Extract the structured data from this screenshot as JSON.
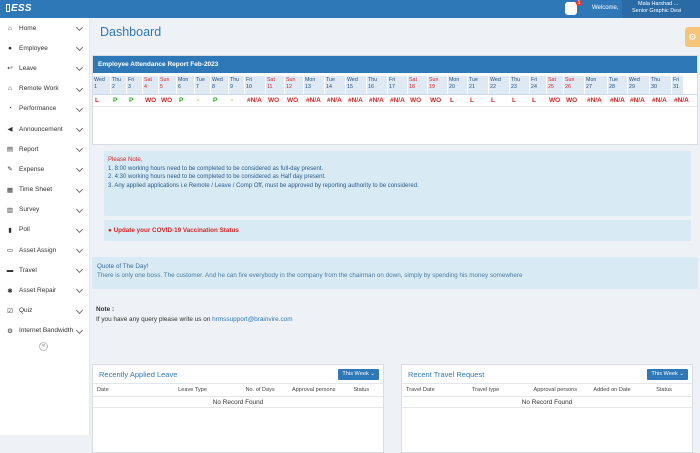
{
  "app": {
    "logo": "ESS",
    "welcome": "Welcome,",
    "user_name": "Mala Harshad ...",
    "user_role": "Senior Graphic Desi",
    "notif_count": "1"
  },
  "sidebar": {
    "items": [
      {
        "label": "Home",
        "icon": "home-icon"
      },
      {
        "label": "Employee",
        "icon": "user-icon"
      },
      {
        "label": "Leave",
        "icon": "leave-icon"
      },
      {
        "label": "Remote Work",
        "icon": "remote-icon"
      },
      {
        "label": "Performance",
        "icon": "performance-icon"
      },
      {
        "label": "Announcement",
        "icon": "megaphone-icon"
      },
      {
        "label": "Report",
        "icon": "report-icon"
      },
      {
        "label": "Expense",
        "icon": "expense-icon"
      },
      {
        "label": "Time Sheet",
        "icon": "timesheet-icon"
      },
      {
        "label": "Survey",
        "icon": "survey-icon"
      },
      {
        "label": "Poll",
        "icon": "poll-icon"
      },
      {
        "label": "Asset Assign",
        "icon": "asset-icon"
      },
      {
        "label": "Travel",
        "icon": "travel-icon"
      },
      {
        "label": "Asset Repair",
        "icon": "wrench-icon"
      },
      {
        "label": "Quiz",
        "icon": "quiz-icon"
      },
      {
        "label": "Internet Bandwidth",
        "icon": "bandwidth-icon"
      }
    ]
  },
  "page": {
    "title": "Dashboard"
  },
  "attendance": {
    "title": "Employee Attendance Report Feb-2023",
    "days": [
      {
        "d": "Wed",
        "n": "1",
        "w": 18,
        "red": false
      },
      {
        "d": "Thu",
        "n": "2",
        "w": 16,
        "red": false
      },
      {
        "d": "Fri",
        "n": "3",
        "w": 16,
        "red": false
      },
      {
        "d": "Sat",
        "n": "4",
        "w": 16,
        "red": true
      },
      {
        "d": "Sun",
        "n": "5",
        "w": 18,
        "red": true
      },
      {
        "d": "Mon",
        "n": "6",
        "w": 18,
        "red": false
      },
      {
        "d": "Tue",
        "n": "7",
        "w": 16,
        "red": false
      },
      {
        "d": "Wed",
        "n": "8",
        "w": 18,
        "red": false
      },
      {
        "d": "Thu",
        "n": "9",
        "w": 16,
        "red": false
      },
      {
        "d": "Fri",
        "n": "10",
        "w": 21,
        "red": false
      },
      {
        "d": "Sat",
        "n": "11",
        "w": 19,
        "red": true
      },
      {
        "d": "Sun",
        "n": "12",
        "w": 19,
        "red": true
      },
      {
        "d": "Mon",
        "n": "13",
        "w": 21,
        "red": false
      },
      {
        "d": "Tue",
        "n": "14",
        "w": 21,
        "red": false
      },
      {
        "d": "Wed",
        "n": "15",
        "w": 21,
        "red": false
      },
      {
        "d": "Thu",
        "n": "16",
        "w": 21,
        "red": false
      },
      {
        "d": "Fri",
        "n": "17",
        "w": 20,
        "red": false
      },
      {
        "d": "Sat",
        "n": "18",
        "w": 20,
        "red": true
      },
      {
        "d": "Sun",
        "n": "19",
        "w": 20,
        "red": true
      },
      {
        "d": "Mon",
        "n": "20",
        "w": 20,
        "red": false
      },
      {
        "d": "Tue",
        "n": "21",
        "w": 21,
        "red": false
      },
      {
        "d": "Wed",
        "n": "22",
        "w": 21,
        "red": false
      },
      {
        "d": "Thu",
        "n": "23",
        "w": 20,
        "red": false
      },
      {
        "d": "Fri",
        "n": "24",
        "w": 17,
        "red": false
      },
      {
        "d": "Sat",
        "n": "25",
        "w": 17,
        "red": true
      },
      {
        "d": "Sun",
        "n": "26",
        "w": 21,
        "red": true
      },
      {
        "d": "Mon",
        "n": "27",
        "w": 23,
        "red": false
      },
      {
        "d": "Tue",
        "n": "28",
        "w": 20,
        "red": false
      },
      {
        "d": "Wed",
        "n": "29",
        "w": 22,
        "red": false
      },
      {
        "d": "Thu",
        "n": "30",
        "w": 22,
        "red": false
      },
      {
        "d": "Fri",
        "n": "31",
        "w": 12,
        "red": false
      }
    ],
    "marks": [
      "L",
      "P",
      "P",
      "WO",
      "WO",
      "P",
      "-",
      "P",
      "-",
      "#N/A",
      "WO",
      "WO",
      "#N/A",
      "#N/A",
      "#N/A",
      "#N/A",
      "#N/A",
      "WO",
      "WO",
      "L",
      "L",
      "L",
      "L",
      "L",
      "WO",
      "WO",
      "#N/A",
      "#N/A",
      "#N/A",
      "#N/A",
      "#N/A"
    ]
  },
  "note": {
    "heading": "Please Note,",
    "lines": [
      "1. 8:00 working hours need to be completed to be considered as full-day present.",
      "2. 4:30 working hours need to be completed to be considered as Half day present.",
      "3. Any applied applications i.e Remote / Leave / Comp Off, must be approved by reporting authority to be considered."
    ]
  },
  "covid": {
    "text": "Update your COVID-19 Vaccination Status"
  },
  "quote": {
    "heading": "Quote of The Day!",
    "text": "There is only one boss. The customer. And he can fire everybody in the company from the chairman on down, simply by spending his money somewhere"
  },
  "contact": {
    "label": "Note :",
    "text": "If you have any query please write us on",
    "email": "hrmssupport@brainvire.com"
  },
  "leave_card": {
    "title": "Recently Applied Leave",
    "filter": "This Week",
    "columns": [
      "Date",
      "Leave Type",
      "No. of Days",
      "Approval persons",
      "Status"
    ],
    "empty": "No Record Found"
  },
  "travel_card": {
    "title": "Recent Travel Request",
    "filter": "This Week",
    "columns": [
      "Travel Date",
      "Travel type",
      "Approval persons",
      "Added on Date",
      "Status"
    ],
    "empty": "No Record Found"
  }
}
